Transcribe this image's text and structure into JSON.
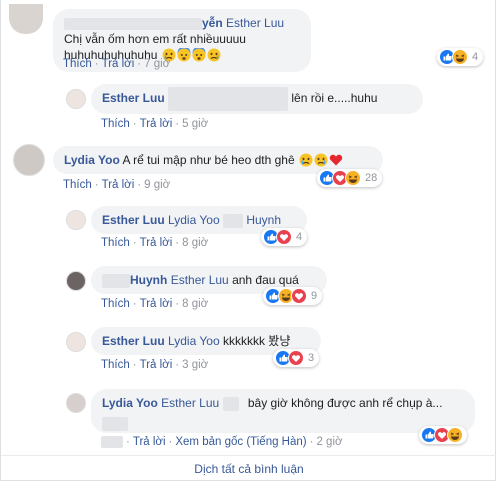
{
  "comments": [
    {
      "name_suffix": "yễn",
      "mention": "Esther Luu",
      "text": "Chị vẫn ốm hơn em rất nhiềuuuuu huhuhuhuhuhuhu",
      "emoji": [
        "crying-face",
        "fearful-face",
        "fearful-face",
        "crying-face"
      ],
      "like": "Thích",
      "reply": "Trả lời",
      "time": "7 giờ",
      "reactions": [
        "like",
        "haha"
      ],
      "reaction_count": "4"
    },
    {
      "name": "Esther Luu",
      "text": "lên rồi e.....huhu",
      "like": "Thích",
      "reply": "Trả lời",
      "time": "5 giờ"
    },
    {
      "name": "Lydia Yoo",
      "text": "A rể tui mập như bé heo dth ghê",
      "emoji": [
        "crying-face",
        "crying-face",
        "red-heart"
      ],
      "like": "Thích",
      "reply": "Trả lời",
      "time": "9 giờ",
      "reactions": [
        "like",
        "love",
        "haha"
      ],
      "reaction_count": "28"
    },
    {
      "name": "Esther Luu",
      "mention": "Lydia Yoo",
      "mention2": "Huynh",
      "like": "Thích",
      "reply": "Trả lời",
      "time": "8 giờ",
      "reactions": [
        "like",
        "love"
      ],
      "reaction_count": "4"
    },
    {
      "name": "Huynh",
      "mention": "Esther Luu",
      "text": "anh đau quá",
      "like": "Thích",
      "reply": "Trả lời",
      "time": "8 giờ",
      "reactions": [
        "like",
        "haha",
        "love"
      ],
      "reaction_count": "9"
    },
    {
      "name": "Esther Luu",
      "mention": "Lydia Yoo",
      "text": "kkkkkkk 봤냥",
      "like": "Thích",
      "reply": "Trả lời",
      "time": "3 giờ",
      "reactions": [
        "like",
        "love"
      ],
      "reaction_count": "3"
    },
    {
      "name": "Lydia Yoo",
      "mention": "Esther Luu",
      "text": "bây giờ không được anh rể chụp à...",
      "reply": "Trả lời",
      "translate": "Xem bản gốc (Tiếng Hàn)",
      "time": "2 giờ",
      "reactions": [
        "like",
        "love",
        "haha"
      ]
    }
  ],
  "footer": {
    "label": "Dịch tất cả bình luận"
  },
  "colors": {
    "link": "#385898",
    "bubble": "#f2f3f5",
    "like": "#1877f2",
    "love": "#e9414f",
    "haha": "#f7b125"
  }
}
